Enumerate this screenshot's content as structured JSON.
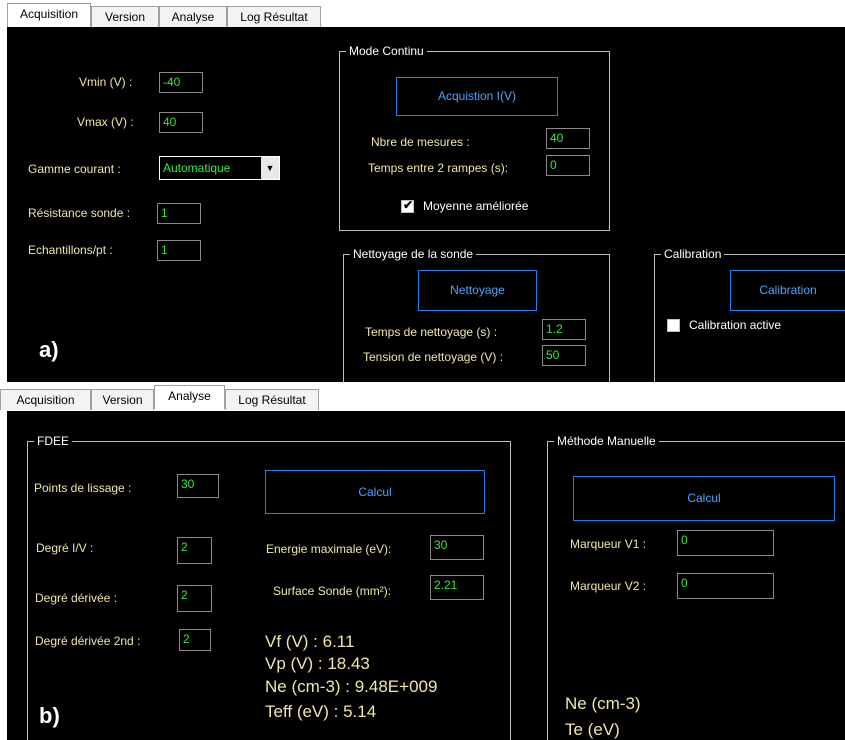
{
  "panel_a": {
    "tabs": [
      "Acquisition",
      "Version",
      "Analyse",
      "Log Résultat"
    ],
    "active_tab": "Acquisition",
    "corner_label": "a)",
    "vmin_label": "Vmin (V) :",
    "vmin_value": "-40",
    "vmax_label": "Vmax (V) :",
    "vmax_value": "40",
    "gamme_label": "Gamme courant :",
    "gamme_value": "Automatique",
    "resistance_label": "Résistance sonde :",
    "resistance_value": "1",
    "echantillons_label": "Echantillons/pt :",
    "echantillons_value": "1",
    "mode_continu": {
      "title": "Mode Continu",
      "button": "Acquistion I(V)",
      "nbre_label": "Nbre de mesures :",
      "nbre_value": "40",
      "temps_label": "Temps entre 2 rampes (s):",
      "temps_value": "0",
      "moyenne_label": "Moyenne améliorée",
      "moyenne_checked": true
    },
    "nettoyage": {
      "title": "Nettoyage de la sonde",
      "button": "Nettoyage",
      "temps_label": "Temps de nettoyage (s) :",
      "temps_value": "1.2",
      "tension_label": "Tension de nettoyage (V) :",
      "tension_value": "50"
    },
    "calibration": {
      "title": "Calibration",
      "button": "Calibration",
      "active_label": "Calibration active",
      "active_checked": false
    }
  },
  "panel_b": {
    "tabs": [
      "Acquisition",
      "Version",
      "Analyse",
      "Log Résultat"
    ],
    "active_tab": "Analyse",
    "corner_label": "b)",
    "fdee": {
      "title": "FDEE",
      "points_label": "Points de lissage :",
      "points_value": "30",
      "calcul_button": "Calcul",
      "degre_iv_label": "Degré I/V :",
      "degre_iv_value": "2",
      "energie_label": "Energie maximale (eV):",
      "energie_value": "30",
      "degre_der_label": "Degré dérivée :",
      "degre_der_value": "2",
      "surface_label": "Surface Sonde (mm²):",
      "surface_value": "2.21",
      "degre_der2_label": "Degré dérivée 2nd :",
      "degre_der2_value": "2",
      "vf": "Vf (V) : 6.11",
      "vp": "Vp (V) :  18.43",
      "ne": "Ne (cm-3) : 9.48E+009",
      "teff": "Teff (eV) : 5.14"
    },
    "manuelle": {
      "title": "Méthode Manuelle",
      "calcul_button": "Calcul",
      "v1_label": "Marqueur V1 :",
      "v1_value": "0",
      "v2_label": "Marqueur V2 :",
      "v2_value": "0",
      "ne": "Ne (cm-3)",
      "te": "Te (eV)"
    }
  }
}
